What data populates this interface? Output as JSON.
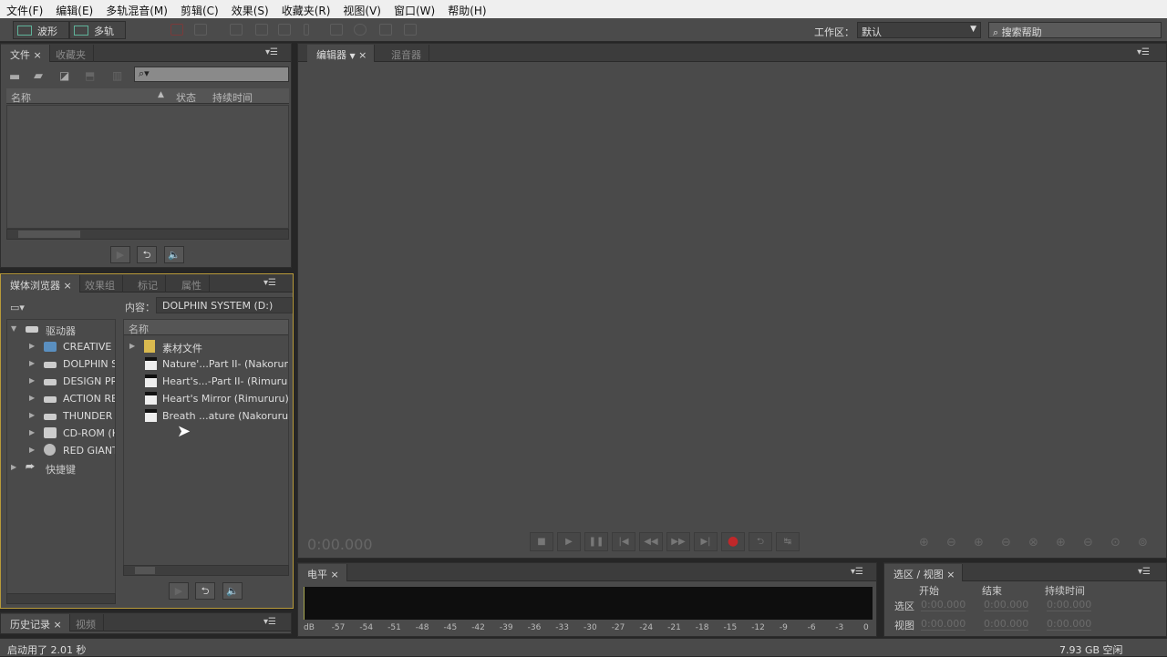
{
  "menu": [
    "文件(F)",
    "编辑(E)",
    "多轨混音(M)",
    "剪辑(C)",
    "效果(S)",
    "收藏夹(R)",
    "视图(V)",
    "窗口(W)",
    "帮助(H)"
  ],
  "toolbar": {
    "waveform_label": "波形",
    "multitrack_label": "多轨",
    "workspace_label": "工作区：",
    "workspace_value": "默认",
    "search_placeholder": "搜索帮助"
  },
  "files_panel": {
    "tabs": [
      "文件",
      "收藏夹"
    ],
    "columns": [
      "名称",
      "状态",
      "持续时间"
    ]
  },
  "editor_panel": {
    "tabs": [
      "编辑器",
      "混音器"
    ],
    "timecode": "0:00.000"
  },
  "media_browser": {
    "tabs": [
      "媒体浏览器",
      "效果组",
      "标记",
      "属性"
    ],
    "content_label": "内容：",
    "content_value": "DOLPHIN SYSTEM (D:)",
    "tree": [
      {
        "label": "驱动器",
        "icon": "drive-icon"
      },
      {
        "label": "CREATIVE C",
        "icon": "network-drive-icon"
      },
      {
        "label": "DOLPHIN S",
        "icon": "drive-icon"
      },
      {
        "label": "DESIGN PRI",
        "icon": "drive-icon"
      },
      {
        "label": "ACTION REI",
        "icon": "drive-icon"
      },
      {
        "label": "THUNDER C",
        "icon": "drive-icon"
      },
      {
        "label": "CD-ROM (H",
        "icon": "cdrom-icon"
      },
      {
        "label": "RED GIANT",
        "icon": "disc-icon"
      },
      {
        "label": "快捷键",
        "icon": "shortcut-icon"
      }
    ],
    "list_header": "名称",
    "files": [
      {
        "label": "素材文件",
        "icon": "folder-icon"
      },
      {
        "label": "Nature'...Part II- (Nakoruru).flac",
        "icon": "audio-file-icon"
      },
      {
        "label": "Heart's...-Part II- (Rimururu).flac",
        "icon": "audio-file-icon"
      },
      {
        "label": "Heart's Mirror (Rimururu).flac",
        "icon": "audio-file-icon"
      },
      {
        "label": "Breath ...ature (Nakoruru).flac",
        "icon": "audio-file-icon"
      }
    ]
  },
  "history_panel": {
    "tabs": [
      "历史记录",
      "视频"
    ]
  },
  "levels_panel": {
    "tab": "电平",
    "scale": [
      "dB",
      "-57",
      "-54",
      "-51",
      "-48",
      "-45",
      "-42",
      "-39",
      "-36",
      "-33",
      "-30",
      "-27",
      "-24",
      "-21",
      "-18",
      "-15",
      "-12",
      "-9",
      "-6",
      "-3",
      "0"
    ]
  },
  "selection_panel": {
    "tab": "选区 / 视图",
    "columns": [
      "开始",
      "结束",
      "持续时间"
    ],
    "rows": [
      {
        "label": "选区",
        "values": [
          "0:00.000",
          "0:00.000",
          "0:00.000"
        ]
      },
      {
        "label": "视图",
        "values": [
          "0:00.000",
          "0:00.000",
          "0:00.000"
        ]
      }
    ]
  },
  "status": {
    "left": "启动用了 2.01 秒",
    "right": "7.93 GB 空闲"
  },
  "colors": {
    "accent_border": "#b89a3a",
    "record": "#c0282a",
    "waveform_icon": "#5fb39a"
  }
}
